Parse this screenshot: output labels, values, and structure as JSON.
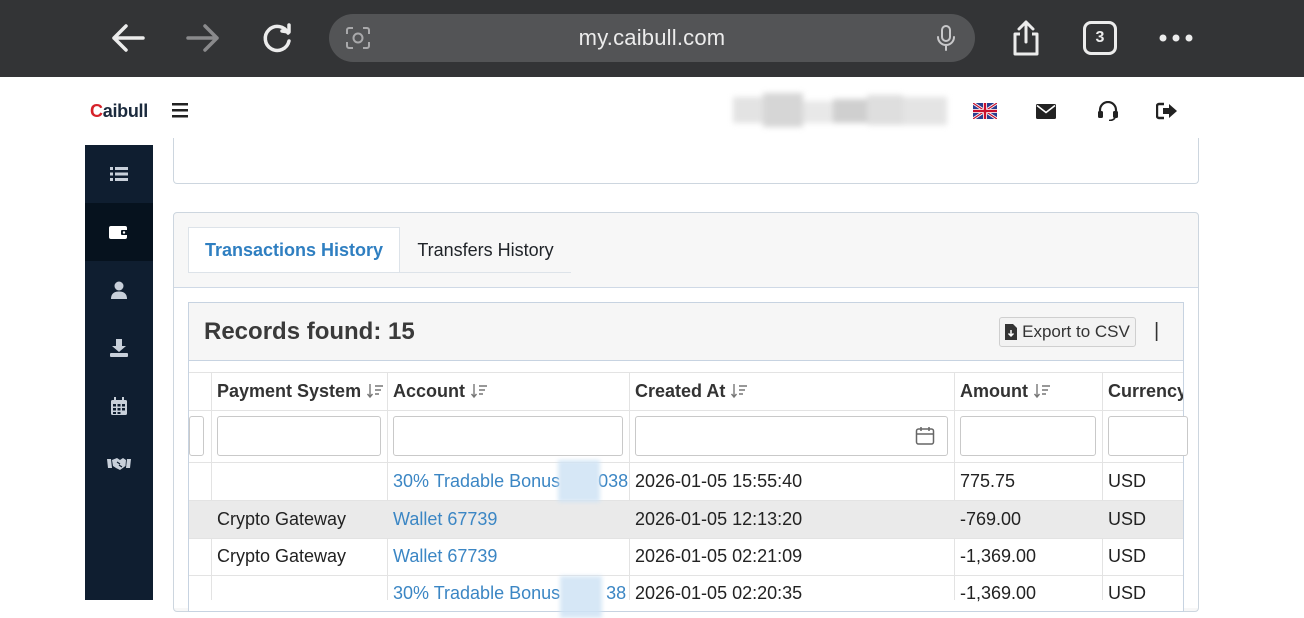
{
  "browser": {
    "url": "my.caibull.com",
    "tab_count": "3"
  },
  "app": {
    "logo_first": "C",
    "logo_rest": "aibull"
  },
  "tabs": [
    {
      "label": "Transactions History",
      "active": true
    },
    {
      "label": "Transfers History",
      "active": false
    }
  ],
  "grid": {
    "records_label": "Records found: 15",
    "export_label": "Export to CSV",
    "separator": "|",
    "columns": [
      "Payment System",
      "Account",
      "Created At",
      "Amount",
      "Currency"
    ],
    "rows": [
      {
        "payment_system": "",
        "account": "30% Tradable Bonus",
        "account_suffix": "038",
        "created_at": "2026-01-05 15:55:40",
        "amount": "775.75",
        "currency": "USD"
      },
      {
        "payment_system": "Crypto Gateway",
        "account": "Wallet 67739",
        "account_suffix": "",
        "created_at": "2026-01-05 12:13:20",
        "amount": "-769.00",
        "currency": "USD"
      },
      {
        "payment_system": "Crypto Gateway",
        "account": "Wallet 67739",
        "account_suffix": "",
        "created_at": "2026-01-05 02:21:09",
        "amount": "-1,369.00",
        "currency": "USD"
      },
      {
        "payment_system": "",
        "account": "30% Tradable Bonus",
        "account_suffix": "38",
        "created_at": "2026-01-05 02:20:35",
        "amount": "-1,369.00",
        "currency": "USD"
      }
    ]
  },
  "colors": {
    "sidebar": "#0f1e30",
    "link": "#3b86c4",
    "active_tab": "#2f7fc1",
    "logo_red": "#d6222a"
  }
}
